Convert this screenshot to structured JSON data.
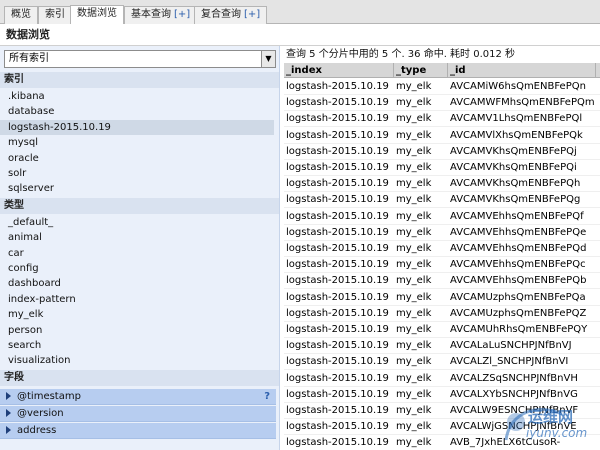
{
  "tabs": [
    {
      "label": "概览",
      "plus": ""
    },
    {
      "label": "索引",
      "plus": ""
    },
    {
      "label": "数据浏览",
      "plus": ""
    },
    {
      "label": "基本查询",
      "plus": "[+]"
    },
    {
      "label": "复合查询",
      "plus": "[+]"
    }
  ],
  "active_tab": "数据浏览",
  "section_title": "数据浏览",
  "sidebar": {
    "index_select_value": "所有索引",
    "indices_header": "索引",
    "indices": [
      ".kibana",
      "database",
      "logstash-2015.10.19",
      "mysql",
      "oracle",
      "solr",
      "sqlserver"
    ],
    "selected_index": "logstash-2015.10.19",
    "types_header": "类型",
    "types": [
      "_default_",
      "animal",
      "car",
      "config",
      "dashboard",
      "index-pattern",
      "my_elk",
      "person",
      "search",
      "visualization"
    ],
    "fields_header": "字段",
    "fields": [
      {
        "name": "@timestamp",
        "help": "?"
      },
      {
        "name": "@version",
        "help": ""
      },
      {
        "name": "address",
        "help": ""
      }
    ]
  },
  "results": {
    "summary": "查询 5 个分片中用的 5 个. 36 命中. 耗时 0.012 秒",
    "columns": [
      "_index",
      "_type",
      "_id"
    ],
    "rows": [
      [
        "logstash-2015.10.19",
        "my_elk",
        "AVCAMiW6hsQmENBFePQn"
      ],
      [
        "logstash-2015.10.19",
        "my_elk",
        "AVCAMWFMhsQmENBFePQm"
      ],
      [
        "logstash-2015.10.19",
        "my_elk",
        "AVCAMV1LhsQmENBFePQl"
      ],
      [
        "logstash-2015.10.19",
        "my_elk",
        "AVCAMVlXhsQmENBFePQk"
      ],
      [
        "logstash-2015.10.19",
        "my_elk",
        "AVCAMVKhsQmENBFePQj"
      ],
      [
        "logstash-2015.10.19",
        "my_elk",
        "AVCAMVKhsQmENBFePQi"
      ],
      [
        "logstash-2015.10.19",
        "my_elk",
        "AVCAMVKhsQmENBFePQh"
      ],
      [
        "logstash-2015.10.19",
        "my_elk",
        "AVCAMVKhsQmENBFePQg"
      ],
      [
        "logstash-2015.10.19",
        "my_elk",
        "AVCAMVEhhsQmENBFePQf"
      ],
      [
        "logstash-2015.10.19",
        "my_elk",
        "AVCAMVEhhsQmENBFePQe"
      ],
      [
        "logstash-2015.10.19",
        "my_elk",
        "AVCAMVEhhsQmENBFePQd"
      ],
      [
        "logstash-2015.10.19",
        "my_elk",
        "AVCAMVEhhsQmENBFePQc"
      ],
      [
        "logstash-2015.10.19",
        "my_elk",
        "AVCAMVEhhsQmENBFePQb"
      ],
      [
        "logstash-2015.10.19",
        "my_elk",
        "AVCAMUzphsQmENBFePQa"
      ],
      [
        "logstash-2015.10.19",
        "my_elk",
        "AVCAMUzphsQmENBFePQZ"
      ],
      [
        "logstash-2015.10.19",
        "my_elk",
        "AVCAMUhRhsQmENBFePQY"
      ],
      [
        "logstash-2015.10.19",
        "my_elk",
        "AVCALaLuSNCHPJNfBnVJ"
      ],
      [
        "logstash-2015.10.19",
        "my_elk",
        "AVCALZl_SNCHPJNfBnVI"
      ],
      [
        "logstash-2015.10.19",
        "my_elk",
        "AVCALZSqSNCHPJNfBnVH"
      ],
      [
        "logstash-2015.10.19",
        "my_elk",
        "AVCALXYbSNCHPJNfBnVG"
      ],
      [
        "logstash-2015.10.19",
        "my_elk",
        "AVCALW9ESNCHPJNfBnVF"
      ],
      [
        "logstash-2015.10.19",
        "my_elk",
        "AVCALWjGSNCHPJNfBnVE"
      ],
      [
        "logstash-2015.10.19",
        "my_elk",
        "AVB_7JxhELX6tCusoR-"
      ]
    ]
  },
  "watermark": {
    "line1": "运维网",
    "line2": "iyunv.com"
  },
  "colors": {
    "sidebar_bg": "#eaf0fa",
    "field_bg": "#b7cdf0",
    "selected_item": "#cfd9e6",
    "header_gray": "#d6d6d6"
  }
}
